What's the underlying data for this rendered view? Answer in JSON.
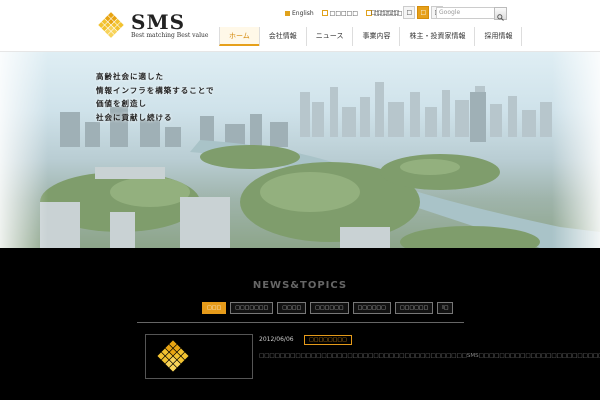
{
  "header": {
    "logo": {
      "title": "SMS",
      "tagline": "Best matching Best value"
    },
    "top_links": [
      {
        "label": "English",
        "style": "filled"
      },
      {
        "label": "□□□□□",
        "style": "outline"
      },
      {
        "label": "□□□□□",
        "style": "outline"
      }
    ],
    "font_size": {
      "label": "□□□□□",
      "buttons": [
        "□",
        "□",
        "□"
      ],
      "active_index": 1
    },
    "search": {
      "placeholder": "Google"
    },
    "nav": [
      {
        "label": "ホーム",
        "active": true
      },
      {
        "label": "会社情報"
      },
      {
        "label": "ニュース"
      },
      {
        "label": "事業内容"
      },
      {
        "label": "株主・投資家情報"
      },
      {
        "label": "採用情報"
      }
    ]
  },
  "hero": {
    "copy": [
      "高齢社会に適した",
      "情報インフラを構築することで",
      "価値を創造し",
      "社会に貢献し続ける"
    ]
  },
  "news": {
    "title": "NEWS&TOPICS",
    "filters": [
      {
        "label": "□□□",
        "active": true
      },
      {
        "label": "□□□□□□□"
      },
      {
        "label": "□□□□"
      },
      {
        "label": "□□□□□□"
      },
      {
        "label": "□□□□□□"
      },
      {
        "label": "□□□□□□"
      },
      {
        "label": "I□"
      }
    ],
    "items": [
      {
        "date": "2012/06/06",
        "category": "□□□□□□□□",
        "body": "□□□□□□□□□□□□□□□□□□□□□□□□□□□□□□□□□□□□□□□□SMS□□□□□□□□□□□□□□□□□□□□□□□□□□□□"
      }
    ]
  },
  "colors": {
    "accent": "#e69b1a",
    "logo_gold": "#f0b81e"
  },
  "icons": {
    "search": "magnifier-icon",
    "logo": "diamond-grid-logo-icon"
  }
}
